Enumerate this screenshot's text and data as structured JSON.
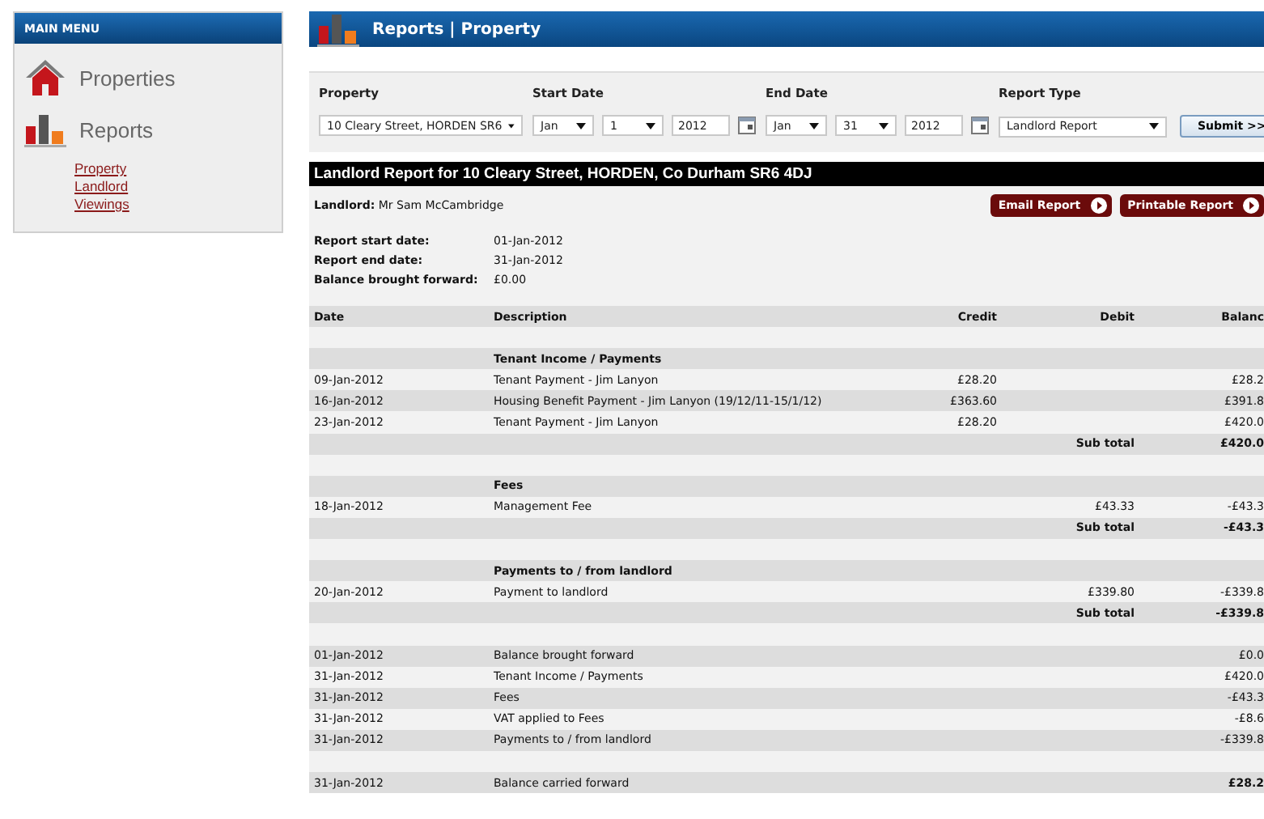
{
  "sidebar": {
    "title": "MAIN MENU",
    "sections": [
      {
        "label": "Properties"
      },
      {
        "label": "Reports",
        "links": [
          "Property",
          "Landlord",
          "Viewings"
        ]
      }
    ]
  },
  "page_header": {
    "title": "Reports | Property"
  },
  "filters": {
    "property": {
      "label": "Property",
      "value": "10 Cleary Street, HORDEN SR6"
    },
    "start_date": {
      "label": "Start Date",
      "month": "Jan",
      "day": "1",
      "year": "2012"
    },
    "end_date": {
      "label": "End Date",
      "month": "Jan",
      "day": "31",
      "year": "2012"
    },
    "report_type": {
      "label": "Report Type",
      "value": "Landlord Report"
    },
    "submit": "Submit >>"
  },
  "report": {
    "title": "Landlord Report for 10 Cleary Street, HORDEN, Co Durham SR6 4DJ",
    "landlord": {
      "label": "Landlord:",
      "value": "Mr Sam McCambridge"
    },
    "actions": [
      "Email Report",
      "Printable Report"
    ],
    "details": [
      {
        "label": "Report start date:",
        "value": "01-Jan-2012"
      },
      {
        "label": "Report end date:",
        "value": "31-Jan-2012"
      },
      {
        "label": "Balance brought forward:",
        "value": "£0.00"
      }
    ],
    "columns": [
      "Date",
      "Description",
      "Credit",
      "Debit",
      "Balanc"
    ],
    "rows": [
      {
        "kind": "blank"
      },
      {
        "kind": "section",
        "description": "Tenant Income / Payments"
      },
      {
        "kind": "entry",
        "date": "09-Jan-2012",
        "description": "Tenant Payment - Jim Lanyon",
        "credit": "£28.20",
        "balance": "£28.2"
      },
      {
        "kind": "entry",
        "date": "16-Jan-2012",
        "description": "Housing Benefit Payment - Jim Lanyon (19/12/11-15/1/12)",
        "credit": "£363.60",
        "balance": "£391.8"
      },
      {
        "kind": "entry",
        "date": "23-Jan-2012",
        "description": "Tenant Payment - Jim Lanyon",
        "credit": "£28.20",
        "balance": "£420.0"
      },
      {
        "kind": "subtotal",
        "label": "Sub total",
        "balance": "£420.0"
      },
      {
        "kind": "blank"
      },
      {
        "kind": "section",
        "description": "Fees"
      },
      {
        "kind": "entry",
        "date": "18-Jan-2012",
        "description": "Management Fee",
        "debit": "£43.33",
        "balance": "-£43.3"
      },
      {
        "kind": "subtotal",
        "label": "Sub total",
        "balance": "-£43.3"
      },
      {
        "kind": "blank"
      },
      {
        "kind": "section",
        "description": "Payments to / from landlord"
      },
      {
        "kind": "entry",
        "date": "20-Jan-2012",
        "description": "Payment to landlord",
        "debit": "£339.80",
        "balance": "-£339.8"
      },
      {
        "kind": "subtotal",
        "label": "Sub total",
        "balance": "-£339.8"
      },
      {
        "kind": "blank"
      },
      {
        "kind": "entry",
        "date": "01-Jan-2012",
        "description": "Balance brought forward",
        "balance": "£0.0"
      },
      {
        "kind": "entry",
        "date": "31-Jan-2012",
        "description": "Tenant Income / Payments",
        "balance": "£420.0"
      },
      {
        "kind": "entry",
        "date": "31-Jan-2012",
        "description": "Fees",
        "balance": "-£43.3"
      },
      {
        "kind": "entry",
        "date": "31-Jan-2012",
        "description": "VAT applied to Fees",
        "balance": "-£8.6"
      },
      {
        "kind": "entry",
        "date": "31-Jan-2012",
        "description": "Payments to / from landlord",
        "balance": "-£339.8"
      },
      {
        "kind": "blank"
      },
      {
        "kind": "total",
        "date": "31-Jan-2012",
        "description": "Balance carried forward",
        "balance": "£28.2"
      }
    ]
  }
}
